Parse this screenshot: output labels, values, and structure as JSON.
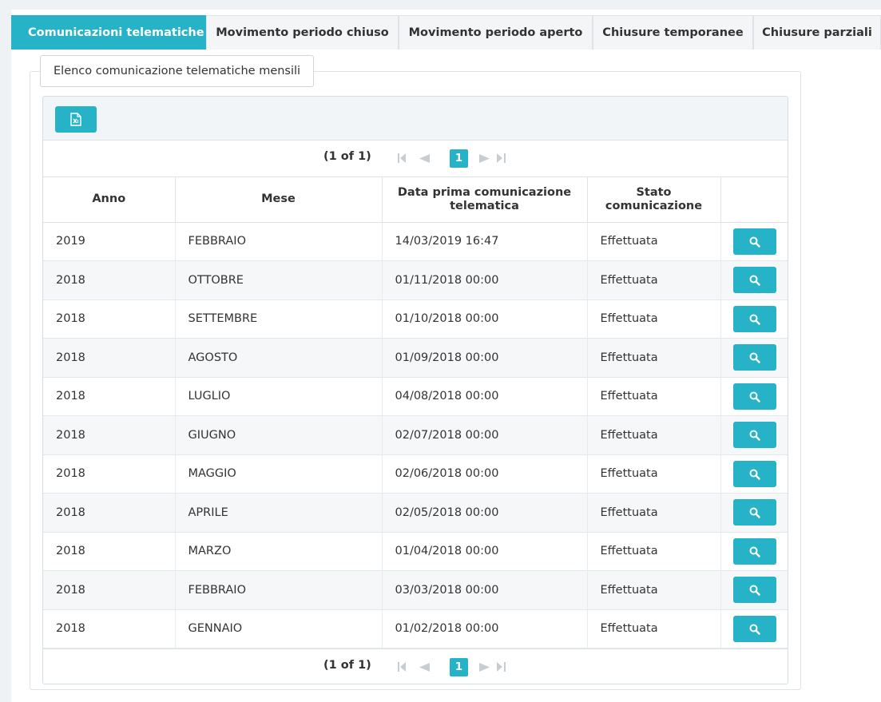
{
  "tabs": [
    {
      "label": "Comunicazioni telematiche",
      "active": true
    },
    {
      "label": "Movimento periodo chiuso",
      "active": false
    },
    {
      "label": "Movimento periodo aperto",
      "active": false
    },
    {
      "label": "Chiusure temporanee",
      "active": false
    },
    {
      "label": "Chiusure parziali",
      "active": false
    }
  ],
  "legend": "Elenco comunicazione telematiche mensili",
  "toolbar": {
    "export_icon": "excel-export-icon"
  },
  "paginator": {
    "info": "(1 of 1)",
    "current_page": "1"
  },
  "table": {
    "headers": [
      "Anno",
      "Mese",
      "Data prima comunicazione telematica",
      "Stato comunicazione",
      ""
    ],
    "rows": [
      {
        "anno": "2019",
        "mese": "FEBBRAIO",
        "data": "14/03/2019 16:47",
        "stato": "Effettuata"
      },
      {
        "anno": "2018",
        "mese": "OTTOBRE",
        "data": "01/11/2018 00:00",
        "stato": "Effettuata"
      },
      {
        "anno": "2018",
        "mese": "SETTEMBRE",
        "data": "01/10/2018 00:00",
        "stato": "Effettuata"
      },
      {
        "anno": "2018",
        "mese": "AGOSTO",
        "data": "01/09/2018 00:00",
        "stato": "Effettuata"
      },
      {
        "anno": "2018",
        "mese": "LUGLIO",
        "data": "04/08/2018 00:00",
        "stato": "Effettuata"
      },
      {
        "anno": "2018",
        "mese": "GIUGNO",
        "data": "02/07/2018 00:00",
        "stato": "Effettuata"
      },
      {
        "anno": "2018",
        "mese": "MAGGIO",
        "data": "02/06/2018 00:00",
        "stato": "Effettuata"
      },
      {
        "anno": "2018",
        "mese": "APRILE",
        "data": "02/05/2018 00:00",
        "stato": "Effettuata"
      },
      {
        "anno": "2018",
        "mese": "MARZO",
        "data": "01/04/2018 00:00",
        "stato": "Effettuata"
      },
      {
        "anno": "2018",
        "mese": "FEBBRAIO",
        "data": "03/03/2018 00:00",
        "stato": "Effettuata"
      },
      {
        "anno": "2018",
        "mese": "GENNAIO",
        "data": "01/02/2018 00:00",
        "stato": "Effettuata"
      }
    ]
  },
  "colors": {
    "accent": "#26b3c7",
    "border": "#dde3e8",
    "zebra": "#f5f7f8"
  }
}
